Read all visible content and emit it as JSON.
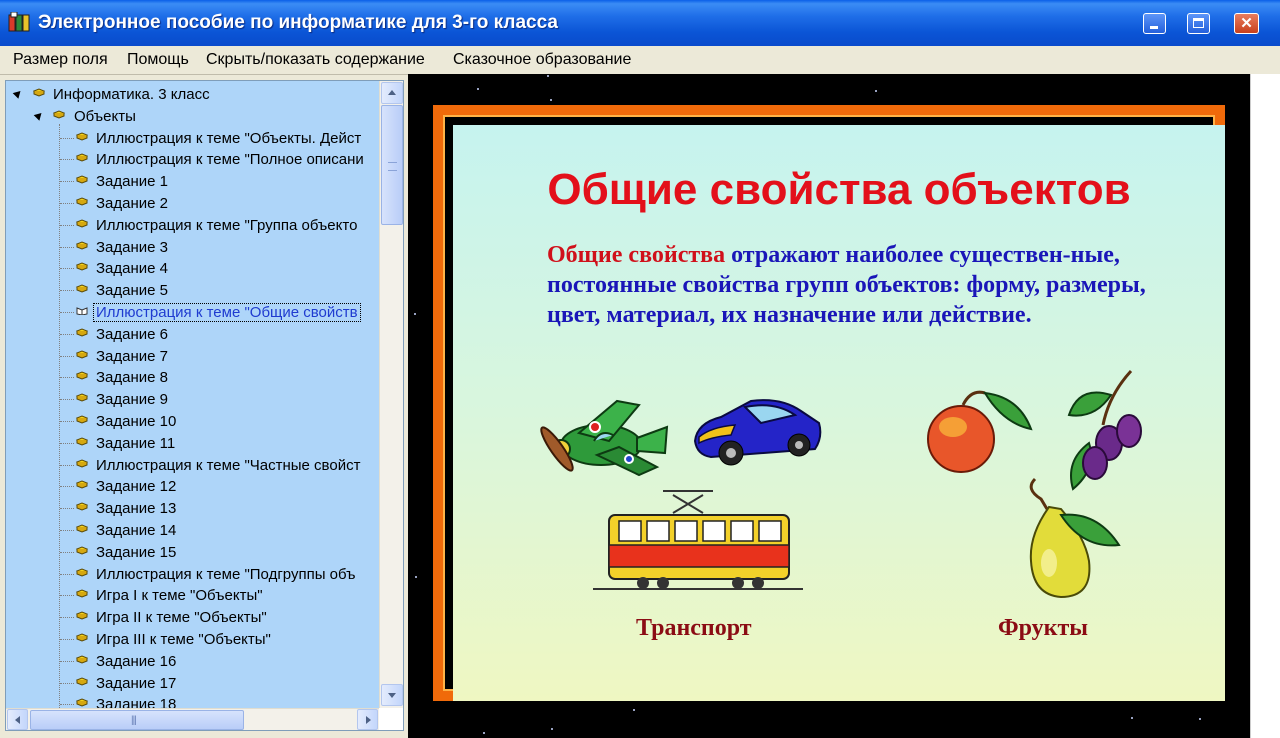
{
  "window": {
    "title": "Электронное пособие по информатике для 3-го класса",
    "icon": "book-app-icon",
    "controls": [
      "minimize-icon",
      "maximize-icon",
      "close-icon"
    ]
  },
  "menu": {
    "items": [
      "Размер поля",
      "Помощь",
      "Скрыть/показать содержание",
      "Сказочное образование"
    ]
  },
  "tree": {
    "root": "Информатика. 3 класс",
    "folder": "Объекты",
    "items": [
      "Иллюстрация к теме \"Объекты. Дейст",
      "Иллюстрация к теме \"Полное описани",
      "Задание 1",
      "Задание 2",
      "Иллюстрация к теме \"Группа объекто",
      "Задание 3",
      "Задание 4",
      "Задание 5",
      "Иллюстрация к теме \"Общие свойств",
      "Задание 6",
      "Задание 7",
      "Задание 8",
      "Задание 9",
      "Задание 10",
      "Задание 11",
      "Иллюстрация к теме \"Частные свойст",
      "Задание 12",
      "Задание 13",
      "Задание 14",
      "Задание 15",
      "Иллюстрация к теме \"Подгруппы объ",
      "Игра I к теме \"Объекты\"",
      "Игра II к теме \"Объекты\"",
      "Игра III к теме \"Объекты\"",
      "Задание 16",
      "Задание 17",
      "Задание 18"
    ],
    "selected_index": 8
  },
  "slide": {
    "title": "Общие свойства объектов",
    "lead": "Общие свойства",
    "text": " отражают наиболее существен-ные, постоянные свойства групп объектов: форму, размеры, цвет, материал, их назначение или действие.",
    "caption_left": "Транспорт",
    "caption_right": "Фрукты",
    "illustrations": [
      "airplane",
      "car",
      "tram",
      "apple",
      "plums",
      "pear"
    ]
  },
  "colors": {
    "title_bar": "#0b55d6",
    "tree_background": "#aed5f9",
    "slide_border": "#f06a0a",
    "slide_title": "#e3101a",
    "body_text": "#1a16b8",
    "caption": "#8b0c14"
  }
}
